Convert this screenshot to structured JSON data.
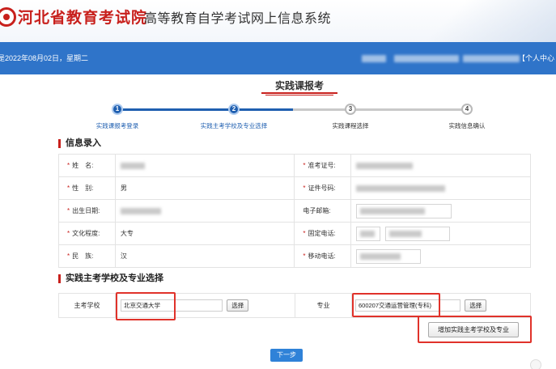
{
  "header": {
    "org_name": "河北省教育考试院",
    "system_name": "高等教育自学考试网上信息系统"
  },
  "topbar": {
    "date_text": "是2022年08月02日，星期二",
    "personal_center": "【个人中心"
  },
  "page": {
    "title": "实践课报考"
  },
  "steps": [
    {
      "num": "1",
      "label": "实践课报考登录",
      "state": "done"
    },
    {
      "num": "2",
      "label": "实践主考学校及专业选择",
      "state": "done"
    },
    {
      "num": "3",
      "label": "实践课程选择",
      "state": "todo"
    },
    {
      "num": "4",
      "label": "实践信息确认",
      "state": "todo"
    }
  ],
  "info_section": {
    "heading": "信息录入",
    "name_label": "姓　名:",
    "exam_no_label": "准考证号:",
    "gender_label": "性　别:",
    "gender_value": "男",
    "id_label": "证件号码:",
    "birth_label": "出生日期:",
    "email_label": "电子邮箱:",
    "edu_label": "文化程度:",
    "edu_value": "大专",
    "phone_label": "固定电话:",
    "ethnic_label": "民　族:",
    "ethnic_value": "汉",
    "mobile_label": "移动电话:"
  },
  "school_section": {
    "heading": "实践主考学校及专业选择",
    "school_label": "主考学校",
    "school_value": "北京交通大学",
    "select_label": "选择",
    "major_label": "专业",
    "major_value": "600207交通运营管理(专科)",
    "add_button": "增加实践主考学校及专业"
  },
  "actions": {
    "next_button": "下一步"
  },
  "colors": {
    "brand_red": "#c8201c",
    "topbar_blue": "#2f74c9",
    "step_blue": "#1f5fb0",
    "highlight_red": "#e0322a"
  }
}
